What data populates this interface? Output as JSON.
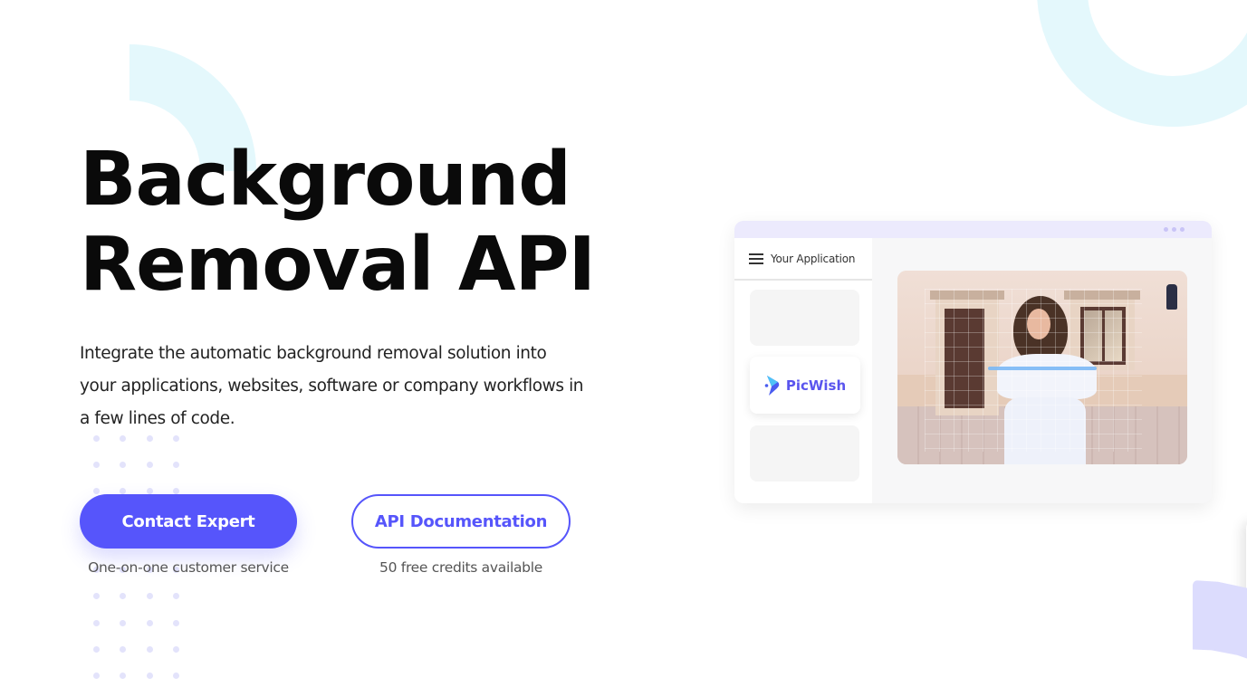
{
  "hero": {
    "title_line1": "Background",
    "title_line2": "Removal API",
    "description": "Integrate the automatic background removal solution into your applications, websites, software or company workflows in a few lines of code."
  },
  "actions": {
    "primary": {
      "label": "Contact Expert",
      "caption": "One-on-one customer service"
    },
    "secondary": {
      "label": "API Documentation",
      "caption": "50 free credits available"
    }
  },
  "mockup": {
    "app_title": "Your Application",
    "brand_name": "PicWish",
    "menu_icon": "hamburger-menu-icon",
    "window_dots_icon": "more-dots-icon"
  },
  "colors": {
    "accent": "#5655fb",
    "decor_cyan": "#e4f8fc",
    "decor_lavender": "#dcdcfd"
  }
}
